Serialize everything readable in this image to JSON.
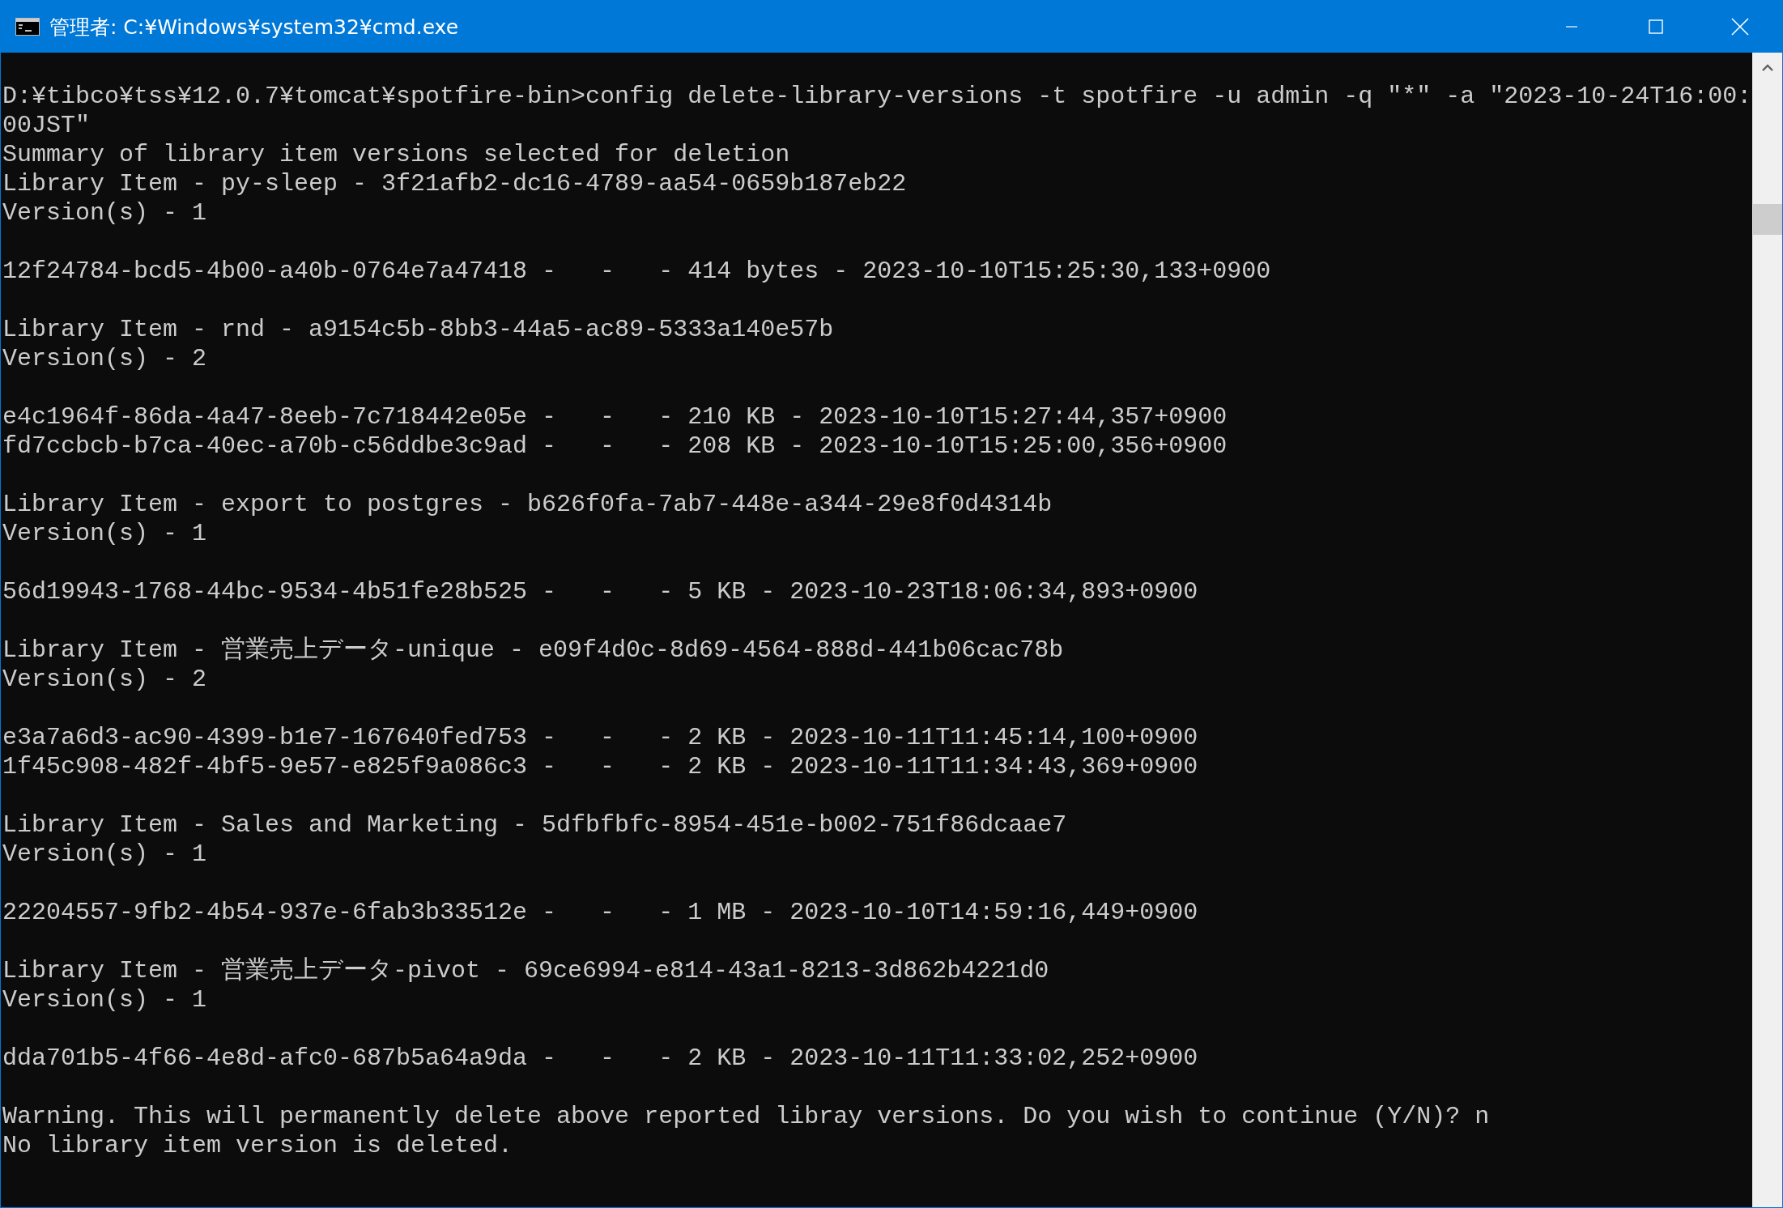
{
  "window": {
    "title": "管理者: C:¥Windows¥system32¥cmd.exe"
  },
  "console": {
    "lines": [
      {
        "kind": "text",
        "text": "D:¥tibco¥tss¥12.0.7¥tomcat¥spotfire-bin>config delete-library-versions -t spotfire -u admin -q ″*″ -a ″2023-10-24T16:00:"
      },
      {
        "kind": "text",
        "text": "00JST″"
      },
      {
        "kind": "text",
        "text": "Summary of library item versions selected for deletion"
      },
      {
        "kind": "text",
        "text": "Library Item - py-sleep - 3f21afb2-dc16-4789-aa54-0659b187eb22"
      },
      {
        "kind": "text",
        "text": "Version(s) - 1"
      },
      {
        "kind": "blank"
      },
      {
        "kind": "text",
        "text": "12f24784-bcd5-4b00-a40b-0764e7a47418 -   -   - 414 bytes - 2023-10-10T15:25:30,133+0900"
      },
      {
        "kind": "blank"
      },
      {
        "kind": "text",
        "text": "Library Item - rnd - a9154c5b-8bb3-44a5-ac89-5333a140e57b"
      },
      {
        "kind": "text",
        "text": "Version(s) - 2"
      },
      {
        "kind": "blank"
      },
      {
        "kind": "text",
        "text": "e4c1964f-86da-4a47-8eeb-7c718442e05e -   -   - 210 KB - 2023-10-10T15:27:44,357+0900"
      },
      {
        "kind": "text",
        "text": "fd7ccbcb-b7ca-40ec-a70b-c56ddbe3c9ad -   -   - 208 KB - 2023-10-10T15:25:00,356+0900"
      },
      {
        "kind": "blank"
      },
      {
        "kind": "text",
        "text": "Library Item - export to postgres - b626f0fa-7ab7-448e-a344-29e8f0d4314b"
      },
      {
        "kind": "text",
        "text": "Version(s) - 1"
      },
      {
        "kind": "blank"
      },
      {
        "kind": "text",
        "text": "56d19943-1768-44bc-9534-4b51fe28b525 -   -   - 5 KB - 2023-10-23T18:06:34,893+0900"
      },
      {
        "kind": "blank"
      },
      {
        "kind": "text",
        "text": "Library Item - 営業売上データ-unique - e09f4d0c-8d69-4564-888d-441b06cac78b"
      },
      {
        "kind": "text",
        "text": "Version(s) - 2"
      },
      {
        "kind": "blank"
      },
      {
        "kind": "text",
        "text": "e3a7a6d3-ac90-4399-b1e7-167640fed753 -   -   - 2 KB - 2023-10-11T11:45:14,100+0900"
      },
      {
        "kind": "text",
        "text": "1f45c908-482f-4bf5-9e57-e825f9a086c3 -   -   - 2 KB - 2023-10-11T11:34:43,369+0900"
      },
      {
        "kind": "blank"
      },
      {
        "kind": "text",
        "text": "Library Item - Sales and Marketing - 5dfbfbfc-8954-451e-b002-751f86dcaae7"
      },
      {
        "kind": "text",
        "text": "Version(s) - 1"
      },
      {
        "kind": "blank"
      },
      {
        "kind": "text",
        "text": "22204557-9fb2-4b54-937e-6fab3b33512e -   -   - 1 MB - 2023-10-10T14:59:16,449+0900"
      },
      {
        "kind": "blank"
      },
      {
        "kind": "text",
        "text": "Library Item - 営業売上データ-pivot - 69ce6994-e814-43a1-8213-3d862b4221d0"
      },
      {
        "kind": "text",
        "text": "Version(s) - 1"
      },
      {
        "kind": "blank"
      },
      {
        "kind": "text",
        "text": "dda701b5-4f66-4e8d-afc0-687b5a64a9da -   -   - 2 KB - 2023-10-11T11:33:02,252+0900"
      },
      {
        "kind": "blank"
      },
      {
        "kind": "text",
        "text": "Warning. This will permanently delete above reported libray versions. Do you wish to continue (Y/N)? n"
      },
      {
        "kind": "text",
        "text": "No library item version is deleted."
      }
    ]
  }
}
